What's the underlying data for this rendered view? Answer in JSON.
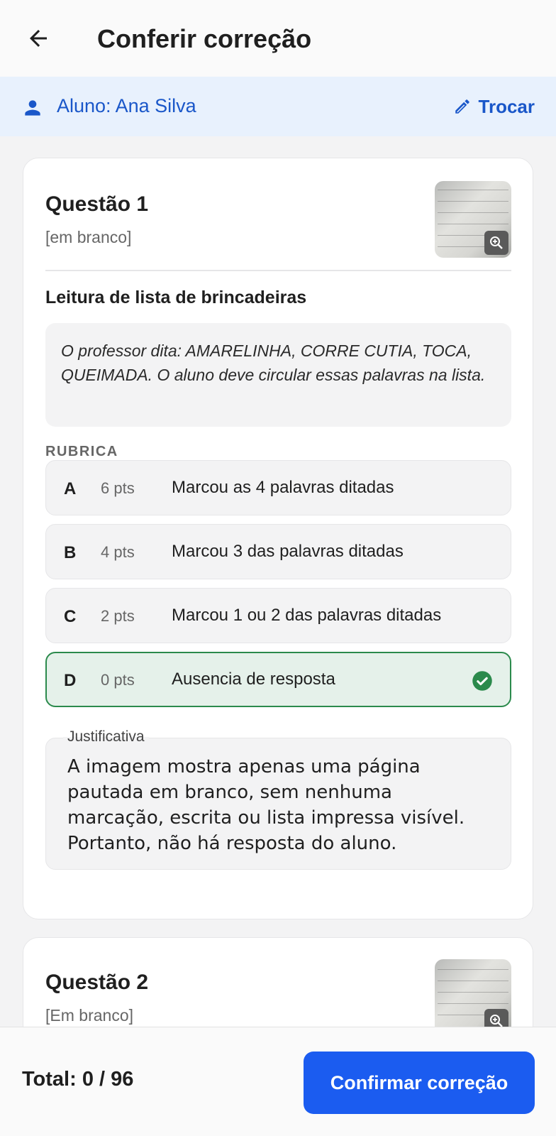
{
  "header": {
    "title": "Conferir correção"
  },
  "student": {
    "label": "Aluno: Ana Silva",
    "change_label": "Trocar"
  },
  "questions": [
    {
      "title": "Questão 1",
      "status": "[em branco]",
      "section_title": "Leitura de lista de brincadeiras",
      "prompt": "O professor dita: AMARELINHA, CORRE CUTIA, TOCA, QUEIMADA. O aluno deve circular essas palavras na lista.",
      "rubric_heading": "RUBRICA",
      "rubric": [
        {
          "letter": "A",
          "points": "6 pts",
          "description": "Marcou as 4 palavras ditadas",
          "selected": false
        },
        {
          "letter": "B",
          "points": "4 pts",
          "description": "Marcou 3 das palavras ditadas",
          "selected": false
        },
        {
          "letter": "C",
          "points": "2 pts",
          "description": "Marcou 1 ou 2 das palavras ditadas",
          "selected": false
        },
        {
          "letter": "D",
          "points": "0 pts",
          "description": "Ausencia de resposta",
          "selected": true
        }
      ],
      "justification_label": "Justificativa",
      "justification": "A imagem mostra apenas uma página pautada em branco, sem nenhuma marcação, escrita ou lista impressa visível. Portanto, não há resposta do aluno."
    },
    {
      "title": "Questão 2",
      "status": "[Em branco]"
    }
  ],
  "footer": {
    "total": "Total: 0 / 96",
    "confirm_label": "Confirmar correção"
  },
  "colors": {
    "accent": "#1b5cf0",
    "link": "#1a57c9",
    "selected_border": "#2b8a4c",
    "selected_bg": "#e5f1ea"
  },
  "icons": {
    "back": "arrow-left-icon",
    "student": "person-icon",
    "change": "pencil-icon",
    "zoom": "zoom-in-icon",
    "check": "check-circle-icon"
  }
}
